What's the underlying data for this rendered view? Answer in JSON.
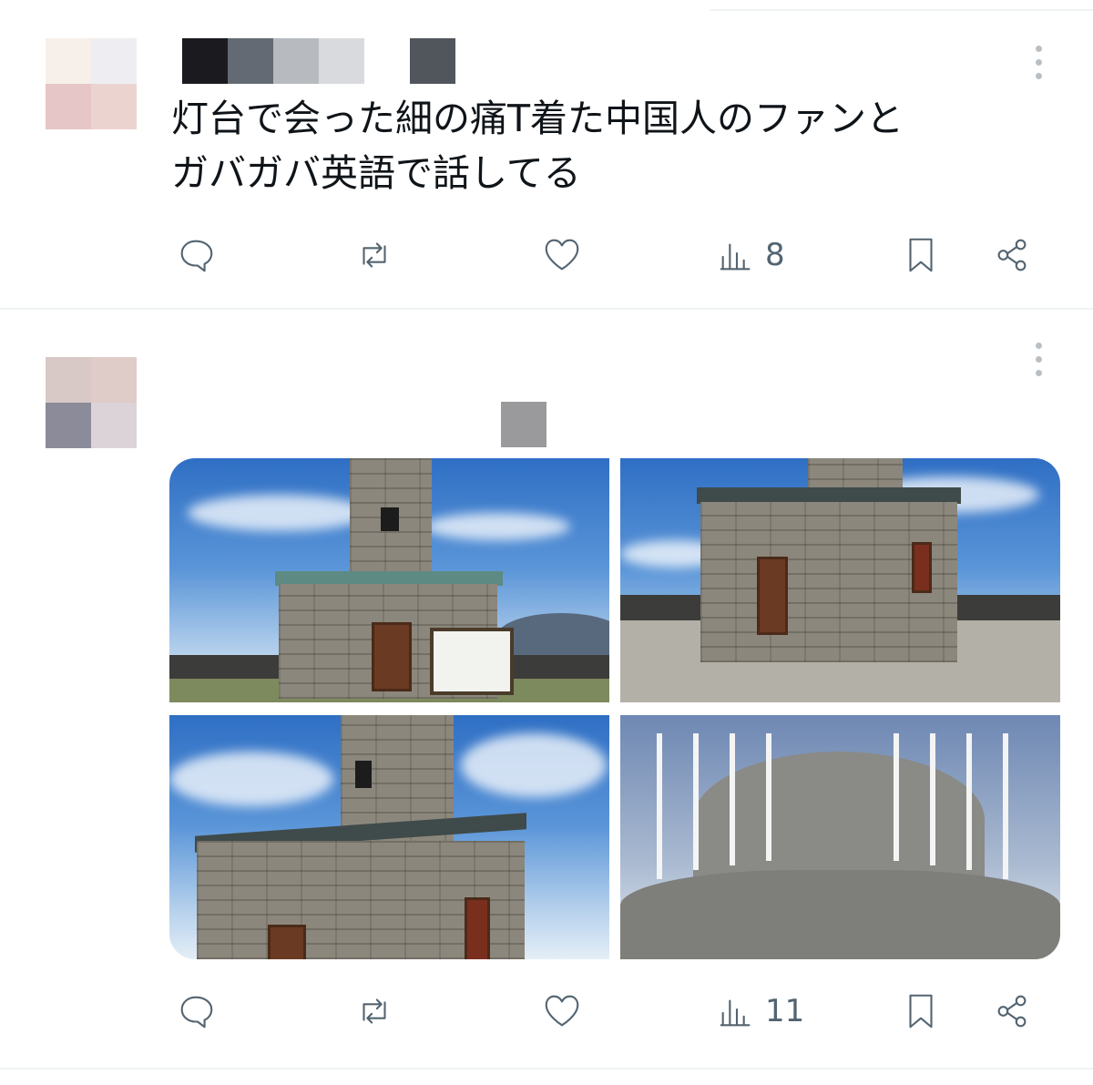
{
  "tweets": [
    {
      "text": "灯台で会った細の痛T着た中国人のファンと\nガバガバ英語で話してる",
      "actions": {
        "views": "8"
      }
    },
    {
      "text": "",
      "actions": {
        "views": "11"
      },
      "photos": [
        "lighthouse-front-with-sign",
        "lighthouse-base-side-view",
        "lighthouse-tower-corner-view",
        "lighthouse-gallery-railing-closeup"
      ]
    }
  ],
  "colors": {
    "text": "#0f1419",
    "icon": "#536471",
    "divider": "#eff3f4"
  },
  "icons": [
    "reply-icon",
    "retweet-icon",
    "like-icon",
    "views-icon",
    "bookmark-icon",
    "share-icon",
    "more-icon"
  ]
}
